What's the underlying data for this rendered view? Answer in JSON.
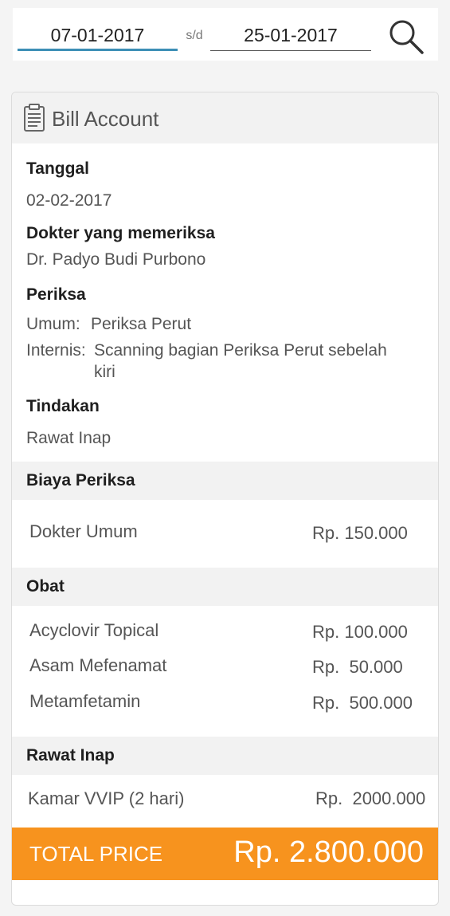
{
  "filter": {
    "date_from": "07-01-2017",
    "separator": "s/d",
    "date_to": "25-01-2017"
  },
  "card": {
    "title": "Bill Account",
    "tanggal_label": "Tanggal",
    "tanggal_value": "02-02-2017",
    "dokter_label": "Dokter yang memeriksa",
    "dokter_value": "Dr. Padyo Budi Purbono",
    "periksa_label": "Periksa",
    "periksa_items": [
      {
        "key": "Umum:",
        "value": "Periksa Perut"
      },
      {
        "key": "Internis:",
        "value": "Scanning bagian Periksa Perut sebelah",
        "value2": "kiri"
      }
    ],
    "tindakan_label": "Tindakan",
    "tindakan_value": "Rawat Inap"
  },
  "sections": {
    "biaya": {
      "title": "Biaya Periksa",
      "items": [
        {
          "name": "Dokter Umum",
          "price": "Rp. 150.000"
        }
      ]
    },
    "obat": {
      "title": "Obat",
      "items": [
        {
          "name": "Acyclovir Topical",
          "price": "Rp. 100.000"
        },
        {
          "name": "Asam Mefenamat",
          "price": "Rp.  50.000"
        },
        {
          "name": "Metamfetamin",
          "price": "Rp.  500.000"
        }
      ]
    },
    "rawat": {
      "title": "Rawat Inap",
      "items": [
        {
          "name": "Kamar VVIP (2 hari)",
          "price": "Rp.  2000.000"
        }
      ]
    }
  },
  "total": {
    "label": "TOTAL PRICE",
    "value": "Rp. 2.800.000"
  },
  "colors": {
    "accent": "#f7931e",
    "active_underline": "#3d8fb6"
  },
  "icons": {
    "search": "search-icon",
    "bill": "clipboard-icon"
  }
}
